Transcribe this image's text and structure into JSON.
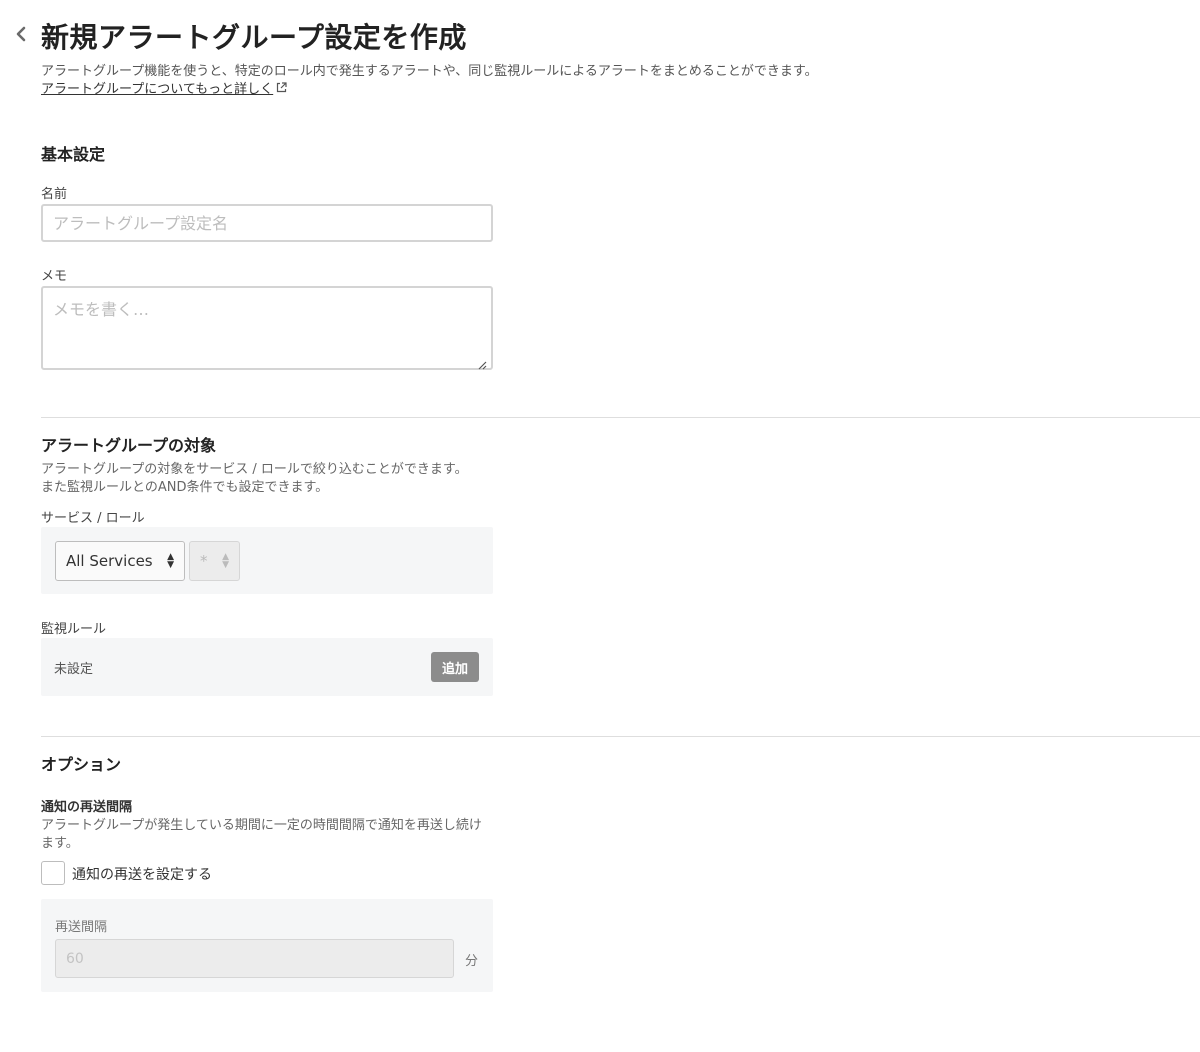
{
  "header": {
    "back_icon": "chevron-left-icon",
    "title": "新規アラートグループ設定を作成",
    "description": "アラートグループ機能を使うと、特定のロール内で発生するアラートや、同じ監視ルールによるアラートをまとめることができます。",
    "learn_more_label": "アラートグループについてもっと詳しく",
    "learn_more_icon": "external-link-icon"
  },
  "basic": {
    "section_title": "基本設定",
    "name_label": "名前",
    "name_placeholder": "アラートグループ設定名",
    "name_value": "",
    "memo_label": "メモ",
    "memo_placeholder": "メモを書く…",
    "memo_value": ""
  },
  "target": {
    "section_title": "アラートグループの対象",
    "help_line1": "アラートグループの対象をサービス / ロールで絞り込むことができます。",
    "help_line2": "また監視ルールとのAND条件でも設定できます。",
    "service_role_label": "サービス / ロール",
    "service_select_value": "All Services",
    "role_select_value": "*",
    "monitor_rule_label": "監視ルール",
    "monitor_rule_value": "未設定",
    "add_button_label": "追加"
  },
  "options": {
    "section_title": "オプション",
    "resend_title": "通知の再送間隔",
    "resend_help": "アラートグループが発生している期間に一定の時間間隔で通知を再送し続けます。",
    "resend_checkbox_label": "通知の再送を設定する",
    "resend_checked": false,
    "interval_label": "再送間隔",
    "interval_value": "60",
    "interval_unit": "分"
  },
  "colors": {
    "add_button_bg": "#8c8c8c",
    "gray_panel_bg": "#f5f6f7",
    "divider": "#dedede"
  }
}
